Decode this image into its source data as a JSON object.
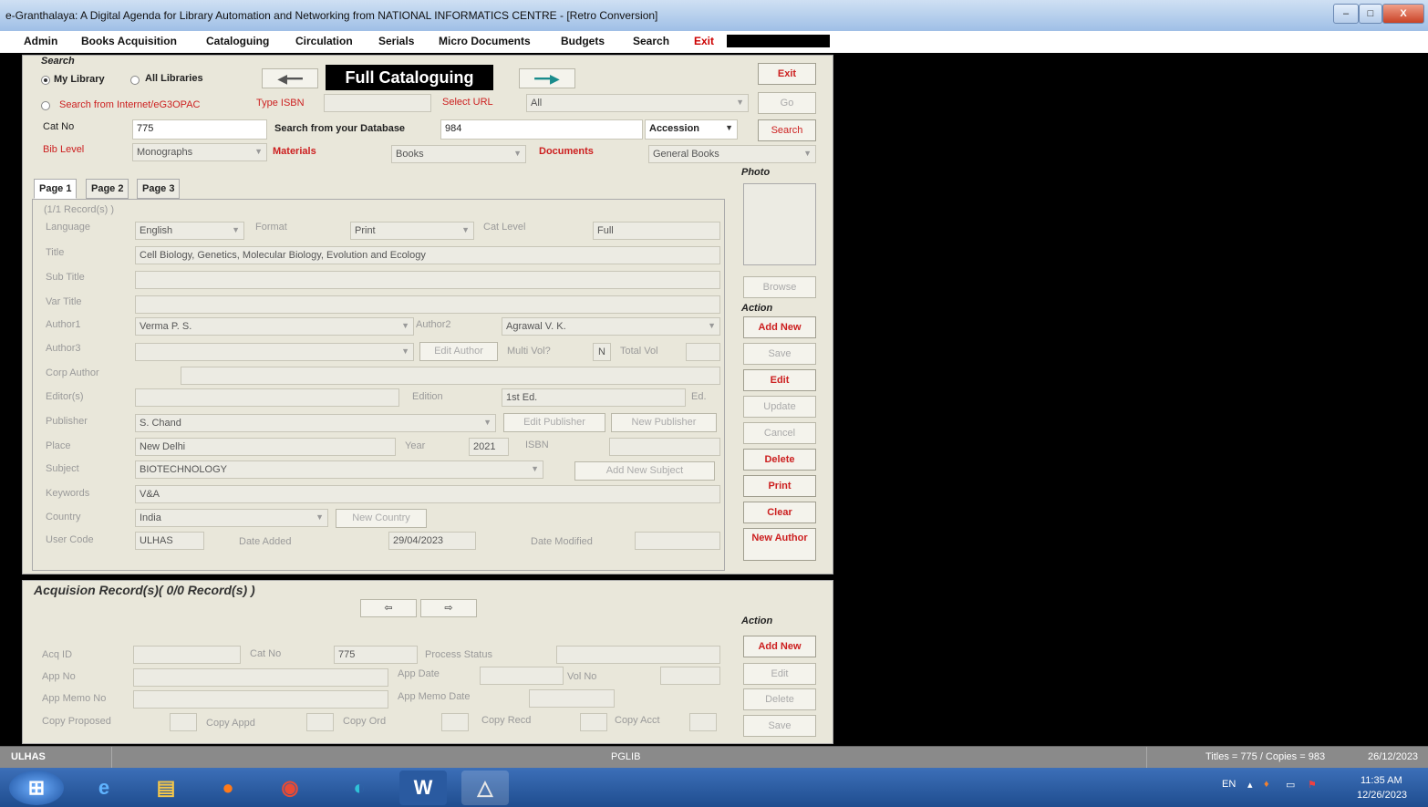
{
  "window": {
    "title": "e-Granthalaya: A Digital Agenda for Library Automation and Networking from NATIONAL INFORMATICS CENTRE - [Retro Conversion]"
  },
  "menu": [
    "Admin",
    "Books Acquisition",
    "Cataloguing",
    "Circulation",
    "Serials",
    "Micro Documents",
    "Budgets",
    "Search",
    "Exit"
  ],
  "search": {
    "title": "Search",
    "my_library": "My Library",
    "all_libraries": "All Libraries",
    "from_internet": "Search from Internet/eG3OPAC",
    "type_isbn": "Type ISBN",
    "select_url": "Select URL",
    "url_value": "All",
    "go": "Go",
    "cat_no_label": "Cat No",
    "cat_no": "775",
    "search_db_label": "Search from your Database",
    "search_db_value": "984",
    "accession": "Accession",
    "search_btn": "Search",
    "bib_label": "Bib Level",
    "bib_value": "Monographs",
    "materials_label": "Materials",
    "materials_value": "Books",
    "documents_label": "Documents",
    "documents_value": "General Books"
  },
  "header": {
    "banner": "Full Cataloguing",
    "exit": "Exit"
  },
  "tabs": [
    "Page 1",
    "Page 2",
    "Page 3"
  ],
  "record": {
    "count": "(1/1 Record(s) )",
    "language_label": "Language",
    "language": "English",
    "format_label": "Format",
    "format": "Print",
    "cat_level_label": "Cat Level",
    "cat_level": "Full",
    "title_label": "Title",
    "title": "Cell Biology, Genetics, Molecular Biology, Evolution and Ecology",
    "sub_title_label": "Sub Title",
    "var_title_label": "Var Title",
    "author1_label": "Author1",
    "author1": "Verma P. S.",
    "author2_label": "Author2",
    "author2": "Agrawal V. K.",
    "author3_label": "Author3",
    "edit_author": "Edit Author",
    "multi_vol_label": "Multi Vol?",
    "multi_vol": "N",
    "total_vol_label": "Total Vol",
    "corp_author_label": "Corp Author",
    "editors_label": "Editor(s)",
    "edition_label": "Edition",
    "edition": "1st Ed.",
    "ed_suffix": "Ed.",
    "publisher_label": "Publisher",
    "publisher": "S. Chand",
    "edit_publisher": "Edit Publisher",
    "new_publisher": "New Publisher",
    "place_label": "Place",
    "place": "New Delhi",
    "year_label": "Year",
    "year": "2021",
    "isbn_label": "ISBN",
    "subject_label": "Subject",
    "subject": "BIOTECHNOLOGY",
    "add_subject": "Add New Subject",
    "keywords_label": "Keywords",
    "keywords": "V&A",
    "country_label": "Country",
    "country": "India",
    "new_country": "New Country",
    "user_code_label": "User Code",
    "user_code": "ULHAS",
    "date_added_label": "Date Added",
    "date_added": "29/04/2023",
    "date_modified_label": "Date Modified"
  },
  "side": {
    "photo": "Photo",
    "browse": "Browse",
    "action": "Action",
    "buttons": [
      "Add New",
      "Save",
      "Edit",
      "Update",
      "Cancel",
      "Delete",
      "Print",
      "Clear",
      "New Author"
    ]
  },
  "acq": {
    "title": "Acquision Record(s)( 0/0 Record(s) )",
    "acq_id_label": "Acq ID",
    "cat_no_label": "Cat No",
    "cat_no": "775",
    "process_label": "Process Status",
    "app_no_label": "App No",
    "app_date_label": "App Date",
    "vol_no_label": "Vol No",
    "app_memo_label": "App Memo No",
    "app_memo_date_label": "App Memo Date",
    "copy_proposed": "Copy Proposed",
    "copy_appd": "Copy Appd",
    "copy_ord": "Copy Ord",
    "copy_recd": "Copy Recd",
    "copy_acct": "Copy Acct",
    "action": "Action",
    "buttons": [
      "Add New",
      "Edit",
      "Delete",
      "Save"
    ]
  },
  "status": {
    "user": "ULHAS",
    "db": "PGLIB",
    "counts": "Titles = 775 / Copies = 983",
    "date": "26/12/2023"
  },
  "taskbar": {
    "lang": "EN",
    "time": "11:35 AM",
    "date": "12/26/2023"
  }
}
